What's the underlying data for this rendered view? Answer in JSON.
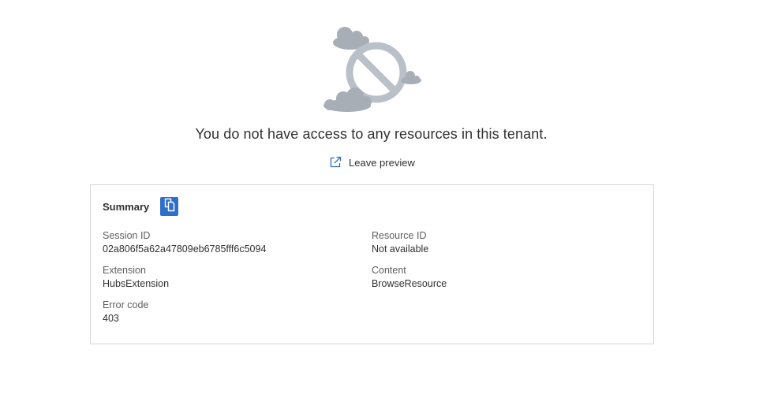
{
  "message": "You do not have access to any resources in this tenant.",
  "leave_preview": {
    "label": "Leave preview",
    "icon": "external-link-icon"
  },
  "summary": {
    "title": "Summary",
    "copy_icon": "copy-icon",
    "fields": {
      "session_id": {
        "label": "Session ID",
        "value": "02a806f5a62a47809eb6785fff6c5094"
      },
      "resource_id": {
        "label": "Resource ID",
        "value": "Not available"
      },
      "extension": {
        "label": "Extension",
        "value": "HubsExtension"
      },
      "content": {
        "label": "Content",
        "value": "BrowseResource"
      },
      "error_code": {
        "label": "Error code",
        "value": "403"
      }
    }
  },
  "colors": {
    "accent": "#2f6fc8",
    "illustration": "#b9c0c8",
    "cloud": "#a7aeb6",
    "border": "#d6d6d6"
  }
}
